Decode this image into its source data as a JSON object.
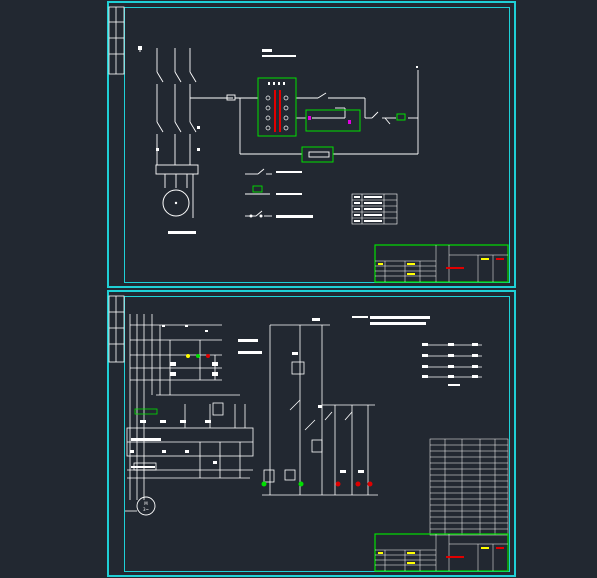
{
  "app": {
    "title": "",
    "background": "#222831",
    "frame_color": "#1fd0d6",
    "wire_color": "#ffffff",
    "highlight_color": "#00e000",
    "accent_magenta": "#e000e0",
    "accent_red": "#e00000"
  },
  "sheets": [
    {
      "id": "sheet-1",
      "motor_label": "",
      "title_block": {
        "drawing_title": ""
      }
    },
    {
      "id": "sheet-2",
      "motor_label": "M\n3~",
      "title_block": {
        "drawing_title": ""
      }
    }
  ],
  "icons": {
    "motor": "motor-symbol-icon",
    "contact": "contact-icon",
    "coil": "coil-icon",
    "indicator_lamp": "lamp-icon"
  }
}
